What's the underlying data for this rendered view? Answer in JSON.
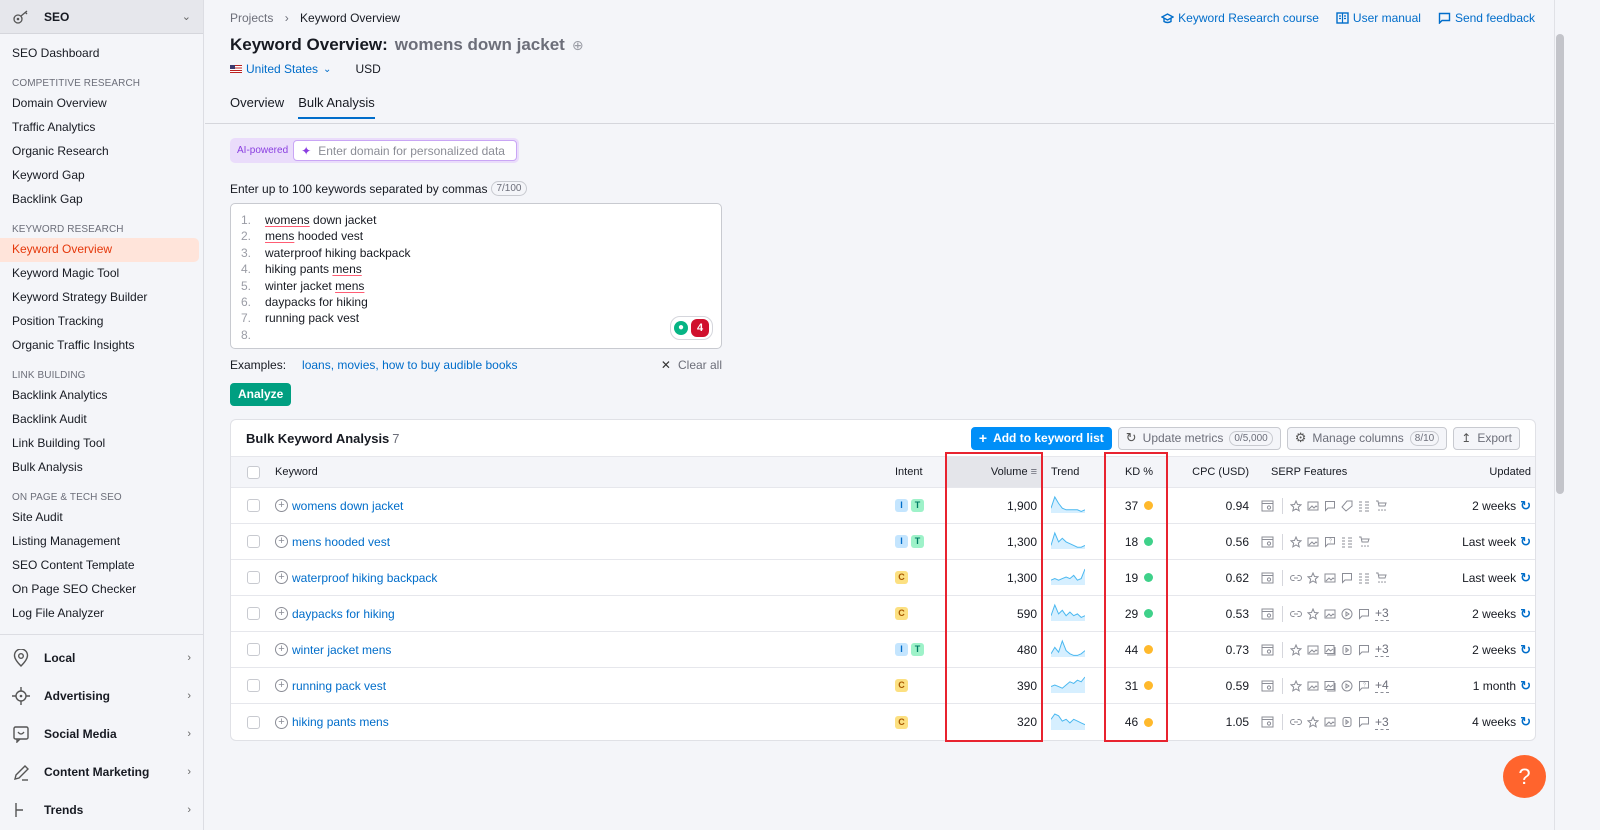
{
  "sidebar": {
    "header": "SEO",
    "dashboard": "SEO Dashboard",
    "sections": [
      {
        "title": "COMPETITIVE RESEARCH",
        "items": [
          "Domain Overview",
          "Traffic Analytics",
          "Organic Research",
          "Keyword Gap",
          "Backlink Gap"
        ]
      },
      {
        "title": "KEYWORD RESEARCH",
        "items": [
          "Keyword Overview",
          "Keyword Magic Tool",
          "Keyword Strategy Builder",
          "Position Tracking",
          "Organic Traffic Insights"
        ]
      },
      {
        "title": "LINK BUILDING",
        "items": [
          "Backlink Analytics",
          "Backlink Audit",
          "Link Building Tool",
          "Bulk Analysis"
        ]
      },
      {
        "title": "ON PAGE & TECH SEO",
        "items": [
          "Site Audit",
          "Listing Management",
          "SEO Content Template",
          "On Page SEO Checker",
          "Log File Analyzer"
        ]
      }
    ],
    "active_item": "Keyword Overview",
    "groups": [
      {
        "label": "Local",
        "icon": "location-pin-icon"
      },
      {
        "label": "Advertising",
        "icon": "crosshair-icon"
      },
      {
        "label": "Social Media",
        "icon": "chat-bubble-icon"
      },
      {
        "label": "Content Marketing",
        "icon": "pencil-icon"
      },
      {
        "label": "Trends",
        "icon": "trends-icon"
      }
    ]
  },
  "breadcrumb": {
    "parent": "Projects",
    "current": "Keyword Overview"
  },
  "top_links": {
    "course": "Keyword Research course",
    "manual": "User manual",
    "feedback": "Send feedback"
  },
  "header": {
    "title": "Keyword Overview:",
    "keyword": "womens down jacket",
    "country": "United States",
    "currency": "USD"
  },
  "tabs": [
    {
      "label": "Overview",
      "active": false
    },
    {
      "label": "Bulk Analysis",
      "active": true
    }
  ],
  "ai": {
    "tag": "AI-powered",
    "placeholder": "Enter domain for personalized data"
  },
  "keywords_input": {
    "label": "Enter up to 100 keywords separated by commas",
    "counter": "7/100",
    "lines": [
      {
        "n": "1.",
        "text": "womens down jacket"
      },
      {
        "n": "2.",
        "text": "mens hooded vest"
      },
      {
        "n": "3.",
        "text": "waterproof hiking backpack"
      },
      {
        "n": "4.",
        "text": "hiking pants mens"
      },
      {
        "n": "5.",
        "text": "winter jacket mens"
      },
      {
        "n": "6.",
        "text": "daypacks for hiking"
      },
      {
        "n": "7.",
        "text": "running pack vest"
      },
      {
        "n": "8.",
        "text": ""
      }
    ],
    "error_count": "4"
  },
  "examples": {
    "label": "Examples:",
    "link": "loans, movies, how to buy audible books",
    "clear": "Clear all"
  },
  "analyze_label": "Analyze",
  "table": {
    "title": "Bulk Keyword Analysis",
    "count": "7",
    "actions": {
      "add": "Add to keyword list",
      "update": "Update metrics",
      "update_count": "0/5,000",
      "manage": "Manage columns",
      "manage_count": "8/10",
      "export": "Export"
    },
    "columns": {
      "keyword": "Keyword",
      "intent": "Intent",
      "volume": "Volume",
      "trend": "Trend",
      "kd": "KD %",
      "cpc": "CPC (USD)",
      "serp": "SERP Features",
      "updated": "Updated"
    },
    "colors": {
      "kd_easy": "#3fd18a",
      "kd_medium": "#ffb92c"
    },
    "rows": [
      {
        "keyword": "womens down jacket",
        "intent": [
          "I",
          "T"
        ],
        "volume": "1,900",
        "trend": [
          3,
          10,
          6,
          3,
          2,
          2,
          2,
          2,
          1,
          2
        ],
        "kd": "37",
        "kd_level": "medium",
        "cpc": "0.94",
        "serp": [
          "star",
          "image",
          "review",
          "tag",
          "list",
          "cart"
        ],
        "more": "",
        "updated": "2 weeks"
      },
      {
        "keyword": "mens hooded vest",
        "intent": [
          "I",
          "T"
        ],
        "volume": "1,300",
        "trend": [
          2,
          9,
          4,
          6,
          4,
          3,
          2,
          1,
          1,
          2
        ],
        "kd": "18",
        "kd_level": "easy",
        "cpc": "0.56",
        "serp": [
          "star",
          "image",
          "faq",
          "list",
          "cart"
        ],
        "more": "",
        "updated": "Last week"
      },
      {
        "keyword": "waterproof hiking backpack",
        "intent": [
          "C"
        ],
        "volume": "1,300",
        "trend": [
          3,
          4,
          3,
          4,
          5,
          4,
          6,
          3,
          4,
          10
        ],
        "kd": "19",
        "kd_level": "easy",
        "cpc": "0.62",
        "serp": [
          "link",
          "star",
          "image",
          "review",
          "list",
          "cart"
        ],
        "more": "",
        "updated": "Last week"
      },
      {
        "keyword": "daypacks for hiking",
        "intent": [
          "C"
        ],
        "volume": "590",
        "trend": [
          3,
          9,
          4,
          6,
          3,
          5,
          3,
          4,
          2,
          3
        ],
        "kd": "29",
        "kd_level": "easy",
        "cpc": "0.53",
        "serp": [
          "link",
          "star",
          "image",
          "video",
          "review"
        ],
        "more": "+3",
        "updated": "2 weeks"
      },
      {
        "keyword": "winter jacket mens",
        "intent": [
          "I",
          "T"
        ],
        "volume": "480",
        "trend": [
          2,
          6,
          3,
          10,
          4,
          2,
          1,
          1,
          2,
          4
        ],
        "kd": "44",
        "kd_level": "medium",
        "cpc": "0.73",
        "serp": [
          "star",
          "image",
          "image2",
          "video2",
          "review"
        ],
        "more": "+3",
        "updated": "2 weeks"
      },
      {
        "keyword": "running pack vest",
        "intent": [
          "C"
        ],
        "volume": "390",
        "trend": [
          4,
          5,
          4,
          3,
          5,
          7,
          6,
          8,
          7,
          10
        ],
        "kd": "31",
        "kd_level": "medium",
        "cpc": "0.59",
        "serp": [
          "star",
          "image",
          "image2",
          "video",
          "faq"
        ],
        "more": "+4",
        "updated": "1 month"
      },
      {
        "keyword": "hiking pants mens",
        "intent": [
          "C"
        ],
        "volume": "320",
        "trend": [
          6,
          9,
          8,
          5,
          6,
          4,
          6,
          5,
          4,
          3
        ],
        "kd": "46",
        "kd_level": "medium",
        "cpc": "1.05",
        "serp": [
          "link",
          "star",
          "image",
          "video2",
          "review"
        ],
        "more": "+3",
        "updated": "4 weeks"
      }
    ]
  },
  "help_label": "?"
}
